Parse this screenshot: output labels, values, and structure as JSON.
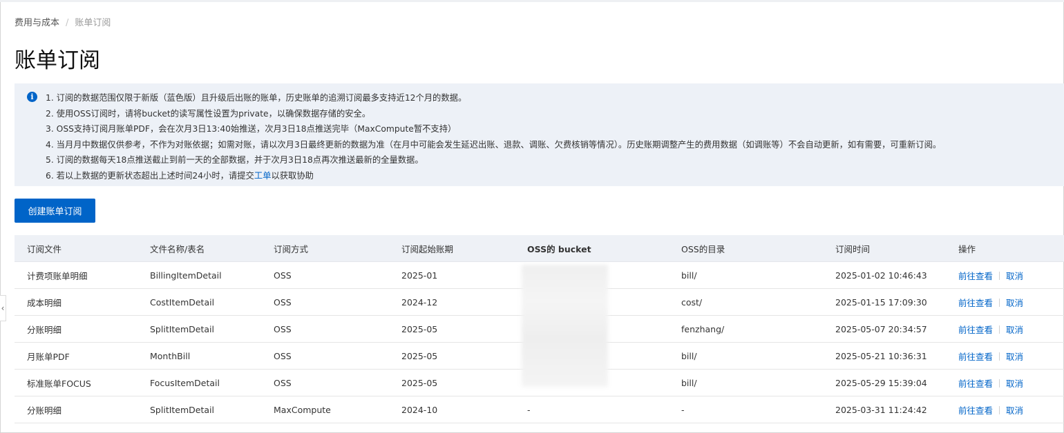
{
  "breadcrumb": {
    "parent": "费用与成本",
    "separator": "/",
    "current": "账单订阅"
  },
  "page_title": "账单订阅",
  "notice": {
    "icon": "info-icon",
    "items": [
      "1. 订阅的数据范围仅限于新版（蓝色版）且升级后出账的账单，历史账单的追溯订阅最多支持近12个月的数据。",
      "2. 使用OSS订阅时，请将bucket的读写属性设置为private，以确保数据存储的安全。",
      "3. OSS支持订阅月账单PDF，会在次月3日13:40始推送，次月3日18点推送完毕（MaxCompute暂不支持）",
      "4. 当月月中数据仅供参考，不作为对账依据；如需对账，请以次月3日最终更新的数据为准（在月中可能会发生延迟出账、退款、调账、欠费核销等情况）。历史账期调整产生的费用数据（如调账等）不会自动更新，如有需要，可重新订阅。",
      "5. 订阅的数据每天18点推送截止到前一天的全部数据，并于次月3日18点再次推送最新的全量数据。"
    ],
    "last_item": {
      "before": "6. 若以上数据的更新状态超出上述时间24小时，请提交",
      "link": "工单",
      "after": "以获取协助"
    }
  },
  "create_button": "创建账单订阅",
  "table": {
    "headers": [
      "订阅文件",
      "文件名称/表名",
      "订阅方式",
      "订阅起始账期",
      "OSS的 bucket",
      "OSS的目录",
      "订阅时间",
      "操作"
    ],
    "rows": [
      {
        "file": "计费项账单明细",
        "name": "BillingItemDetail",
        "method": "OSS",
        "start": "2025-01",
        "bucket": "",
        "dir": "bill/",
        "time": "2025-01-02 10:46:43",
        "view": "前往查看",
        "cancel": "取消"
      },
      {
        "file": "成本明细",
        "name": "CostItemDetail",
        "method": "OSS",
        "start": "2024-12",
        "bucket": "",
        "dir": "cost/",
        "time": "2025-01-15 17:09:30",
        "view": "前往查看",
        "cancel": "取消"
      },
      {
        "file": "分账明细",
        "name": "SplitItemDetail",
        "method": "OSS",
        "start": "2025-05",
        "bucket": "",
        "dir": "fenzhang/",
        "time": "2025-05-07 20:34:57",
        "view": "前往查看",
        "cancel": "取消"
      },
      {
        "file": "月账单PDF",
        "name": "MonthBill",
        "method": "OSS",
        "start": "2025-05",
        "bucket": "",
        "dir": "bill/",
        "time": "2025-05-21 10:36:31",
        "view": "前往查看",
        "cancel": "取消"
      },
      {
        "file": "标准账单FOCUS",
        "name": "FocusItemDetail",
        "method": "OSS",
        "start": "2025-05",
        "bucket": "",
        "dir": "bill/",
        "time": "2025-05-29 15:39:04",
        "view": "前往查看",
        "cancel": "取消"
      },
      {
        "file": "分账明细",
        "name": "SplitItemDetail",
        "method": "MaxCompute",
        "start": "2024-10",
        "bucket": "-",
        "dir": "-",
        "time": "2025-03-31 11:24:42",
        "view": "前往查看",
        "cancel": "取消"
      }
    ]
  },
  "sidebar_toggle": "chevron-left-icon"
}
